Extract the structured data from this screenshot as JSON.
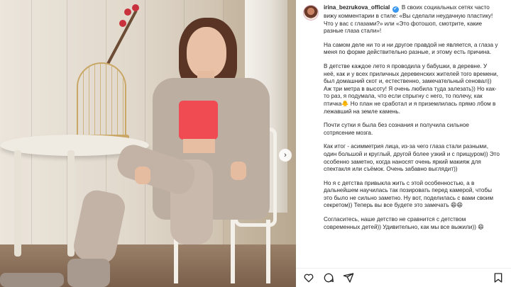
{
  "post": {
    "username": "irina_bezrukova_official",
    "verified_glyph": "✔",
    "paragraphs": [
      "В своих социальных сетях часто вижу комментарии в стиле: «Вы сделали неудачную пластику! Что у вас с глазами?» или «Это фотошоп, смотрите, какие разные глаза стали»!",
      "На самом деле ни то и ни другое правдой не является, а глаза у меня по форме действительно разные, и этому есть причина.",
      "В детстве каждое лето я проводила у бабушки, в деревне. У неё, как и у всех приличных деревенских жителей того времени, был домашний скот и, естественно, замечательный сеновал)) Аж три метра в высоту! Я очень любила туда залезать)) Но как-то раз, я подумала, что если спрыгну с него, то полечу, как птичка🐥 Но план не сработал и я приземлилась прямо лбом в лежавший на земле камень.",
      "Почти сутки я была без сознания и получила сильное сотрясение мозга.",
      "Как итог - асимметрия лица, из-за чего глаза стали разными, один большой и круглый, другой более узкий и с прищуром)) Это особенно заметно, когда наносят очень яркий макияж для спектакля или съёмок. Очень забавно выглядит))",
      "Но я с детства привыкла жить с этой особенностью, а в дальнейшем научилась так позировать перед камерой, чтобы это было не сильно заметно. Ну вот, поделилась с вами своим секретом)) Теперь вы все будете это замечать 😄😄",
      "Согласитесь, наше детство не сравнится с детством современных детей)) Удивительно, как мы все выжили)) 😄"
    ]
  },
  "photo": {
    "alt_label": "Woman sitting on white chair in beige suit",
    "next_glyph": "›"
  },
  "actions": {
    "icons": [
      "heart-icon",
      "comment-icon",
      "share-icon",
      "bookmark-icon"
    ]
  },
  "colors": {
    "verified": "#3897f0",
    "text": "#262626",
    "top_accent": "#f04a52"
  }
}
